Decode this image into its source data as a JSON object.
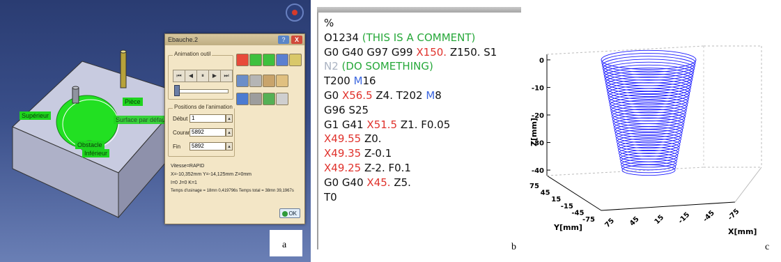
{
  "panel_letters": {
    "a": "a",
    "b": "b",
    "c": "c"
  },
  "cad": {
    "face_tags": {
      "superieur": "Supérieur",
      "piece": "Pièce",
      "surface_par_defaut": "Surface par défaut",
      "obstacle": "Obstacle",
      "inferieur": "Inférieur"
    },
    "dialog": {
      "title": "Ebauche.2",
      "help_label": "?",
      "close_label": "X",
      "animation_group": "Animation outil",
      "media_buttons": [
        "⏮",
        "◀",
        "⏸",
        "▶",
        "⏭"
      ],
      "positions_group": "Positions de l'animation",
      "debut_label": "Début",
      "debut_value": "1",
      "courante_label": "Courante",
      "courante_value": "5892",
      "fin_label": "Fin",
      "fin_value": "5892",
      "info_lines": [
        "Vitesse=RAPID",
        "X=-10,352mm Y=-14,125mm Z=0mm",
        "I=0 J=0 K=1",
        "Temps d'usinage = 18mn 0,419796s   Temps total = 38mn 39,1967s"
      ],
      "ok_label": "OK"
    },
    "colors": {
      "tag": "#1fd41f",
      "pocket": "#22e022",
      "dialog_bg": "#f3e6c6"
    }
  },
  "gcode": {
    "lines": [
      [
        {
          "t": "%",
          "c": ""
        }
      ],
      [
        {
          "t": "O1234 ",
          "c": ""
        },
        {
          "t": "(THIS IS A COMMENT)",
          "c": "c-green"
        }
      ],
      [
        {
          "t": "G0 G40 G97 G99 ",
          "c": ""
        },
        {
          "t": "X150.",
          "c": "c-red"
        },
        {
          "t": " Z150. S1",
          "c": ""
        }
      ],
      [
        {
          "t": "N2 ",
          "c": "c-grey"
        },
        {
          "t": "(DO SOMETHING)",
          "c": "c-green"
        }
      ],
      [
        {
          "t": "T200 ",
          "c": ""
        },
        {
          "t": "M",
          "c": "c-blue"
        },
        {
          "t": "16",
          "c": ""
        }
      ],
      [
        {
          "t": "G0 ",
          "c": ""
        },
        {
          "t": "X56.5",
          "c": "c-red"
        },
        {
          "t": " Z4. T202 ",
          "c": ""
        },
        {
          "t": "M",
          "c": "c-blue"
        },
        {
          "t": "8",
          "c": ""
        }
      ],
      [
        {
          "t": "G96 S25",
          "c": ""
        }
      ],
      [
        {
          "t": "G1 G41 ",
          "c": ""
        },
        {
          "t": "X51.5",
          "c": "c-red"
        },
        {
          "t": " Z1. F0.05",
          "c": ""
        }
      ],
      [
        {
          "t": "X49.55",
          "c": "c-red"
        },
        {
          "t": " Z0.",
          "c": ""
        }
      ],
      [
        {
          "t": "X49.35",
          "c": "c-red"
        },
        {
          "t": " Z-0.1",
          "c": ""
        }
      ],
      [
        {
          "t": "X49.25",
          "c": "c-red"
        },
        {
          "t": " Z-2. F0.1",
          "c": ""
        }
      ],
      [
        {
          "t": "G0 G40 ",
          "c": ""
        },
        {
          "t": "X45.",
          "c": "c-red"
        },
        {
          "t": " Z5.",
          "c": ""
        }
      ],
      [
        {
          "t": "T0",
          "c": ""
        }
      ]
    ]
  },
  "plot3d": {
    "z_label": "Z[mm]",
    "y_label": "Y[mm]",
    "x_label": "X[mm]",
    "z_ticks": [
      "0",
      "-10",
      "-20",
      "-30",
      "-40"
    ],
    "y_ticks": [
      "75",
      "45",
      "15",
      "-15",
      "-45",
      "-75"
    ],
    "x_ticks": [
      "75",
      "45",
      "15",
      "-15",
      "-45",
      "-75"
    ],
    "z_range": [
      -42,
      2
    ],
    "radius_top": 68,
    "radius_bottom": 38,
    "ring_count": 40,
    "line_color": "#1a1aff"
  }
}
